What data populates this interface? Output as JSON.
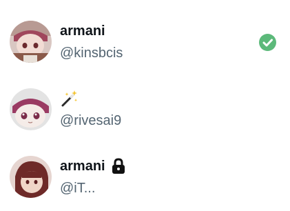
{
  "users": [
    {
      "display_name": "armani",
      "handle": "@kinsbcis",
      "badge_icon": "verified-check-icon",
      "badge_color": "#5cb97a"
    },
    {
      "display_name_icon": "magic-wand-emoji",
      "handle": "@rivesai9"
    },
    {
      "display_name": "armani",
      "name_suffix_icon": "lock-emoji",
      "handle": "@iT..."
    }
  ],
  "colors": {
    "name": "#0f1419",
    "handle": "#536471",
    "verified": "#5cb97a"
  }
}
